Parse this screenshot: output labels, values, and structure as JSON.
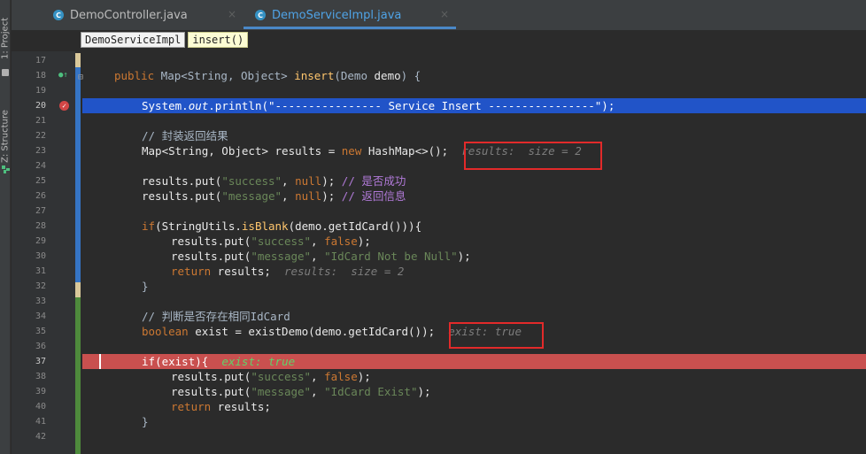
{
  "tool_strip": {
    "project_label": "1: Project",
    "structure_label": "Z: Structure"
  },
  "tabs": [
    {
      "label": "DemoController.java",
      "close": "×"
    },
    {
      "label": "DemoServiceImpl.java",
      "close": "×"
    }
  ],
  "tab_icon_glyph": "C",
  "breadcrumb": [
    "DemoServiceImpl",
    "insert()"
  ],
  "colors": {
    "execution_line": "#2154c8",
    "breakpoint_line": "#c9504f",
    "annotation_box": "#e22a2a"
  },
  "lines": {
    "l17": "17",
    "l18": "18",
    "l19": "19",
    "l20": "20",
    "l21": "21",
    "l22": "22",
    "l23": "23",
    "l24": "24",
    "l25": "25",
    "l26": "26",
    "l27": "27",
    "l28": "28",
    "l29": "29",
    "l30": "30",
    "l31": "31",
    "l32": "32",
    "l33": "33",
    "l34": "34",
    "l35": "35",
    "l36": "36",
    "l37": "37",
    "l38": "38",
    "l39": "39",
    "l40": "40",
    "l41": "41",
    "l42": "42"
  },
  "code": {
    "l18_kw": "public",
    "l18_a": " Map<String, Object> ",
    "l18_fn": "insert",
    "l18_b": "(Demo ",
    "l18_param": "demo",
    "l18_c": ") {",
    "l20_a": "System.",
    "l20_b": "out",
    "l20_c": ".println(",
    "l20_str": "\"---------------- Service Insert ----------------\"",
    "l20_d": ");",
    "l22_cm": "// 封装返回结果",
    "l23_a": "Map<String, Object> results = ",
    "l23_kw": "new",
    "l23_b": " HashMap<>();",
    "l23_hint": "results:  size = 2",
    "l25_a": "results.put(",
    "l25_str": "\"success\"",
    "l25_b": ", ",
    "l25_kw": "null",
    "l25_c": "); ",
    "l25_cm": "// 是否成功",
    "l26_a": "results.put(",
    "l26_str": "\"message\"",
    "l26_b": ", ",
    "l26_kw": "null",
    "l26_c": "); ",
    "l26_cm": "// 返回信息",
    "l28_kw": "if",
    "l28_a": "(StringUtils.",
    "l28_fn": "isBlank",
    "l28_b": "(demo.getIdCard())){",
    "l29_a": "results.put(",
    "l29_str": "\"success\"",
    "l29_b": ", ",
    "l29_kw": "false",
    "l29_c": ");",
    "l30_a": "results.put(",
    "l30_str": "\"message\"",
    "l30_b": ", ",
    "l30_str2": "\"IdCard Not be Null\"",
    "l30_c": ");",
    "l31_kw": "return",
    "l31_a": " results;",
    "l31_hint": "results:  size = 2",
    "l32_a": "}",
    "l34_cm": "// 判断是否存在相同IdCard",
    "l35_kw": "boolean",
    "l35_a": " exist = existDemo(demo.getIdCard());",
    "l35_hint": "exist: true",
    "l37_kw": "if",
    "l37_a": "(exist){",
    "l37_hint": "exist: true",
    "l38_a": "results.put(",
    "l38_str": "\"success\"",
    "l38_b": ", ",
    "l38_kw": "false",
    "l38_c": ");",
    "l39_a": "results.put(",
    "l39_str": "\"message\"",
    "l39_b": ", ",
    "l39_str2": "\"IdCard Exist\"",
    "l39_c": ");",
    "l40_kw": "return",
    "l40_a": " results;",
    "l41_a": "}"
  },
  "icons": {
    "fold": "fold-minus-icon",
    "breakpoint": "breakpoint-check-icon",
    "implements": "implements-arrow-icon"
  }
}
